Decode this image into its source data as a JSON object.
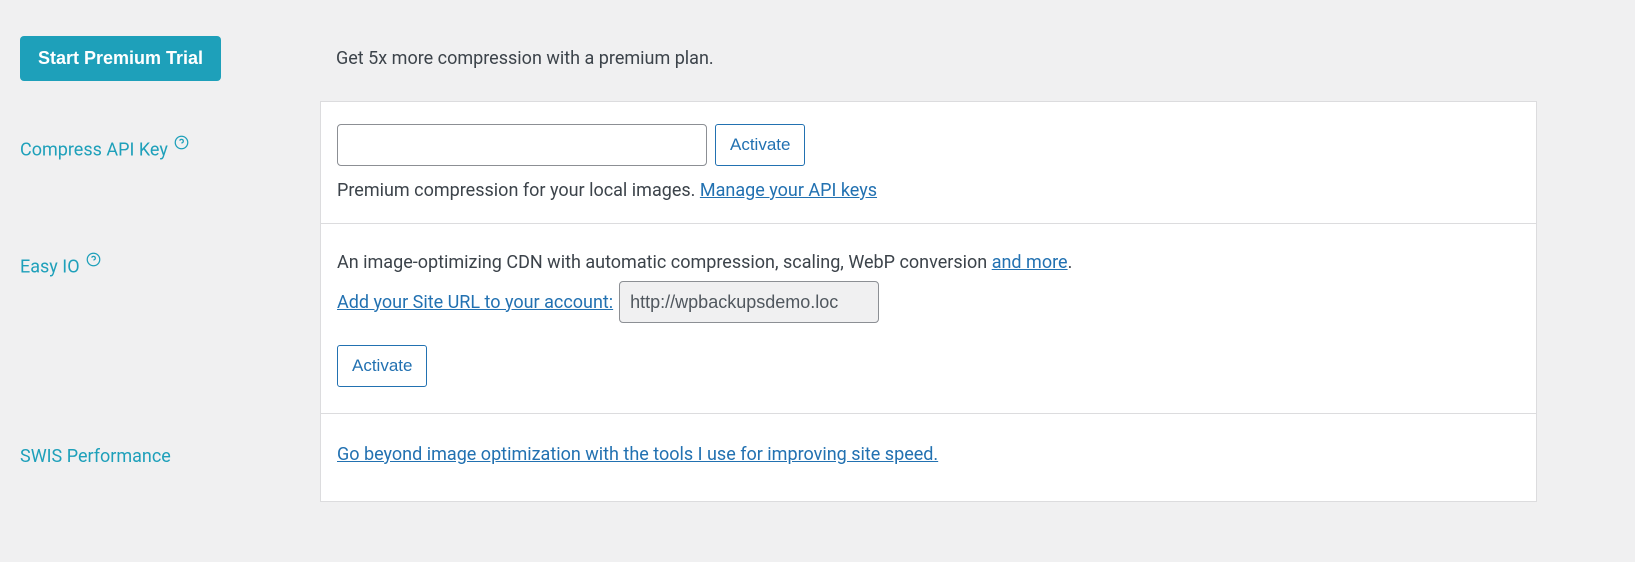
{
  "premium": {
    "button_label": "Start Premium Trial",
    "description": "Get 5x more compression with a premium plan."
  },
  "api_key": {
    "label": "Compress API Key",
    "input_value": "",
    "activate_label": "Activate",
    "description_prefix": "Premium compression for your local images. ",
    "manage_link": "Manage your API keys"
  },
  "easy_io": {
    "label": "Easy IO",
    "description_prefix": "An image-optimizing CDN with automatic compression, scaling, WebP conversion ",
    "and_more_link": "and more",
    "description_suffix": ".",
    "add_url_link": "Add your Site URL to your account:",
    "site_url_value": "http://wpbackupsdemo.loc",
    "activate_label": "Activate"
  },
  "swis": {
    "label": "SWIS Performance",
    "link_text": "Go beyond image optimization with the tools I use for improving site speed."
  }
}
